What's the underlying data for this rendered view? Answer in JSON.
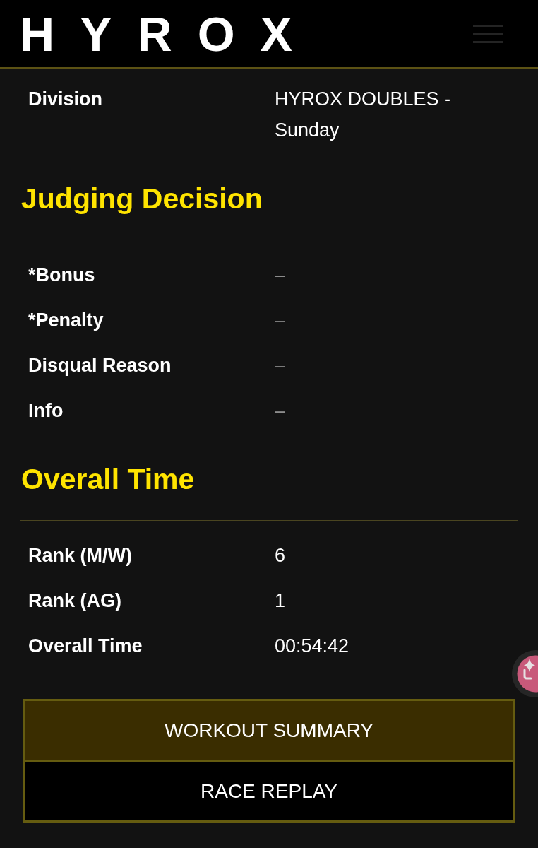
{
  "header": {
    "logo": "HYROX"
  },
  "sections": [
    {
      "rows": [
        {
          "label": "Division",
          "value": "HYROX DOUBLES - Sunday",
          "muted": false
        }
      ]
    },
    {
      "heading": "Judging Decision",
      "rows": [
        {
          "label": "*Bonus",
          "value": "–",
          "muted": true
        },
        {
          "label": "*Penalty",
          "value": "–",
          "muted": true
        },
        {
          "label": "Disqual Reason",
          "value": "–",
          "muted": true
        },
        {
          "label": "Info",
          "value": "–",
          "muted": true
        }
      ]
    },
    {
      "heading": "Overall Time",
      "rows": [
        {
          "label": "Rank (M/W)",
          "value": "6",
          "muted": false
        },
        {
          "label": "Rank (AG)",
          "value": "1",
          "muted": false
        },
        {
          "label": "Overall Time",
          "value": "00:54:42",
          "muted": false
        }
      ]
    }
  ],
  "buttons": [
    {
      "label": "WORKOUT SUMMARY",
      "selected": true
    },
    {
      "label": "RACE REPLAY",
      "selected": false
    }
  ]
}
